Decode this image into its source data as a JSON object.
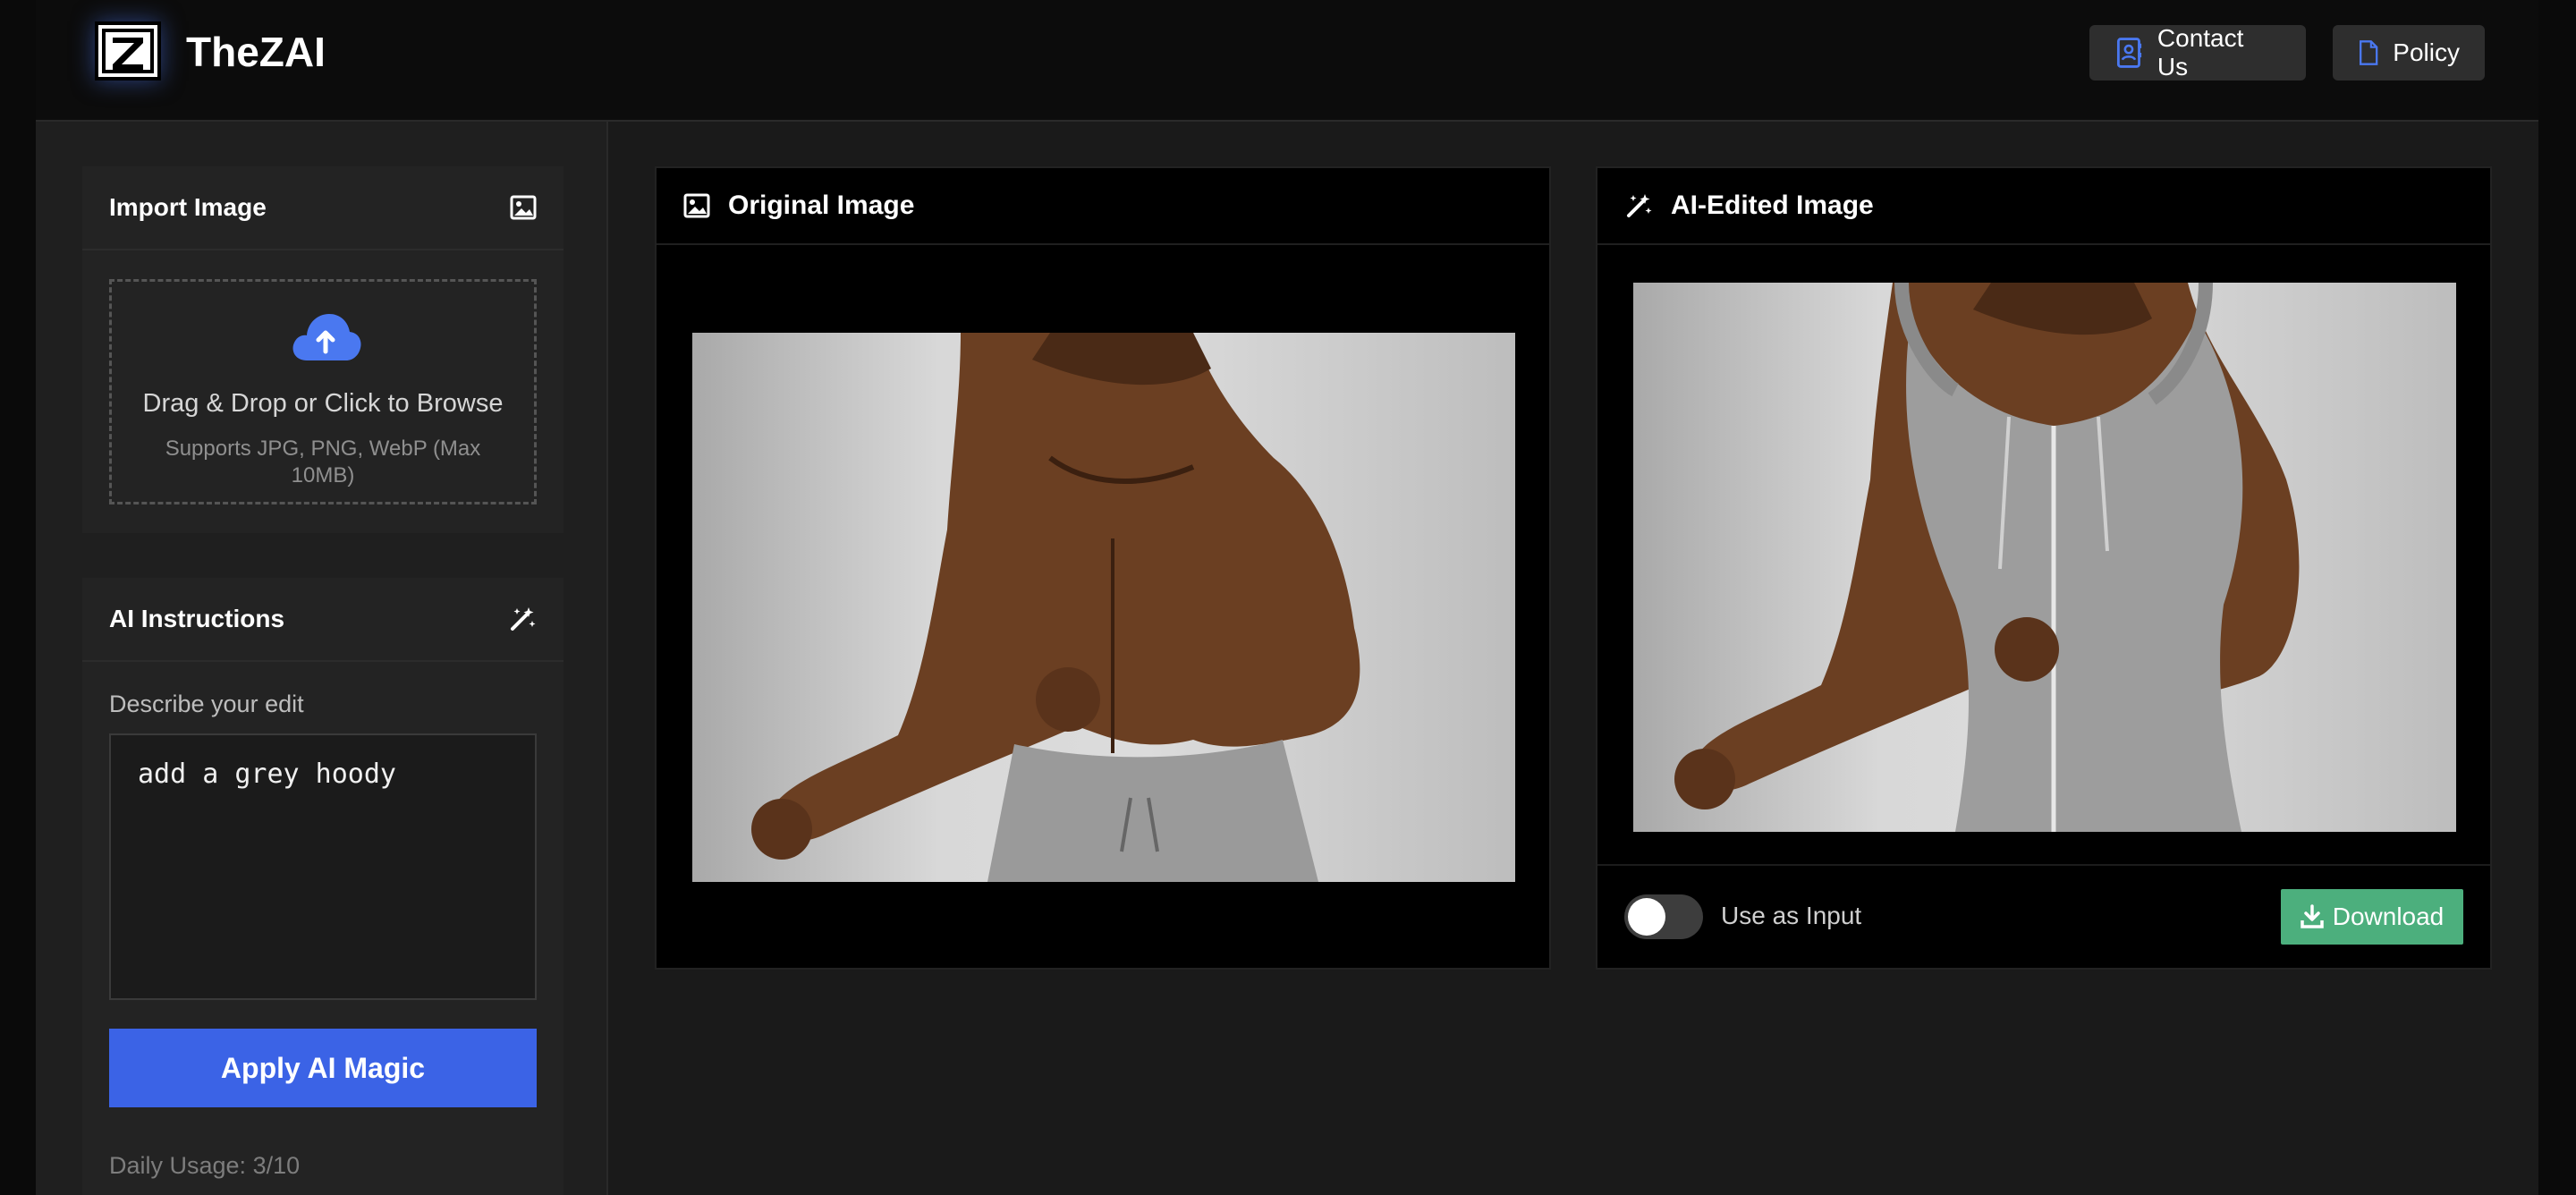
{
  "header": {
    "brand": "TheZAI",
    "logo_letter": "Z",
    "buttons": [
      {
        "label": "Contact Us",
        "icon": "contact-book-icon"
      },
      {
        "label": "Policy",
        "icon": "document-icon"
      }
    ]
  },
  "sidebar": {
    "import": {
      "title": "Import Image",
      "icon": "image-icon",
      "dropzone_main": "Drag & Drop or Click to Browse",
      "dropzone_sub": "Supports JPG, PNG, WebP (Max 10MB)",
      "upload_icon": "cloud-upload-icon"
    },
    "instructions": {
      "title": "AI Instructions",
      "icon": "magic-wand-icon",
      "label": "Describe your edit",
      "textarea_value": "add a grey hoody",
      "apply_label": "Apply AI Magic",
      "usage": "Daily Usage: 3/10"
    }
  },
  "panels": {
    "original": {
      "title": "Original Image",
      "icon": "image-icon"
    },
    "edited": {
      "title": "AI-Edited Image",
      "icon": "magic-wand-icon",
      "toggle_label": "Use as Input",
      "toggle_on": false,
      "download_label": "Download",
      "download_icon": "download-icon"
    }
  },
  "colors": {
    "accent_blue": "#3b63e6",
    "download_green": "#4caf7d",
    "icon_blue": "#4a78f0"
  }
}
